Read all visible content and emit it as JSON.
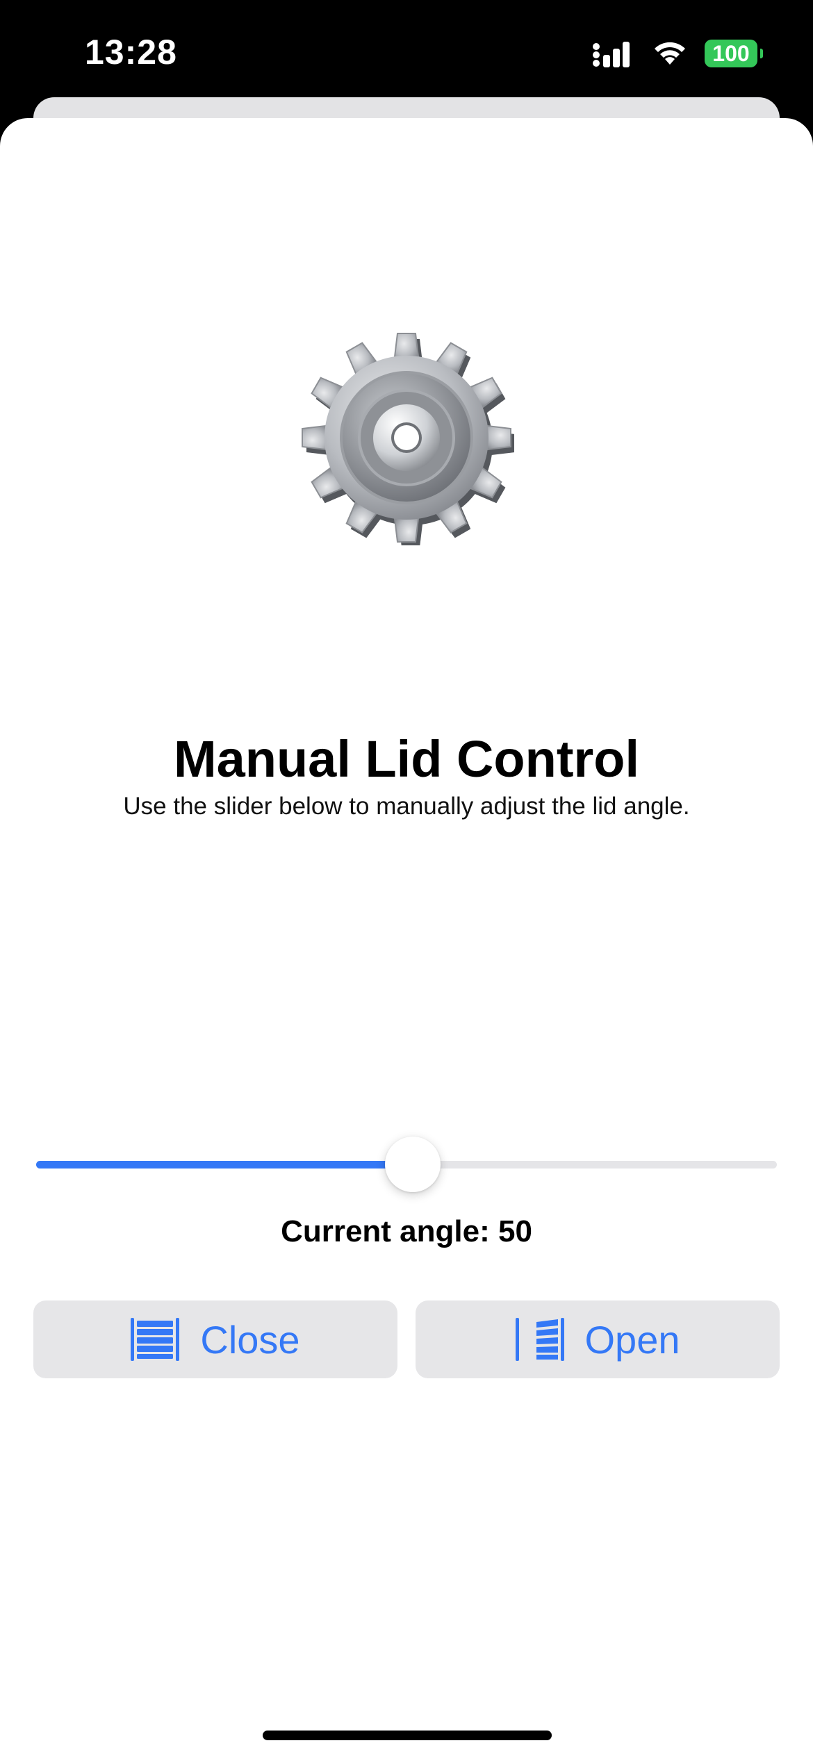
{
  "status_bar": {
    "time": "13:28",
    "battery": "100",
    "icons": [
      "cellular-signal-icon",
      "wifi-icon",
      "battery-icon"
    ]
  },
  "header": {
    "icon": "gear-icon",
    "title": "Manual Lid Control",
    "subtitle": "Use the slider below to manually adjust the lid angle."
  },
  "slider": {
    "value": 50,
    "min": 0,
    "max": 100
  },
  "angle_label": "Current angle: 50",
  "buttons": {
    "close": {
      "label": "Close",
      "icon": "lid-closed-icon"
    },
    "open": {
      "label": "Open",
      "icon": "lid-open-icon"
    }
  },
  "colors": {
    "accent": "#3478f6",
    "button_bg": "#e6e6e8",
    "track": "#e5e5e8",
    "battery": "#34c759"
  }
}
